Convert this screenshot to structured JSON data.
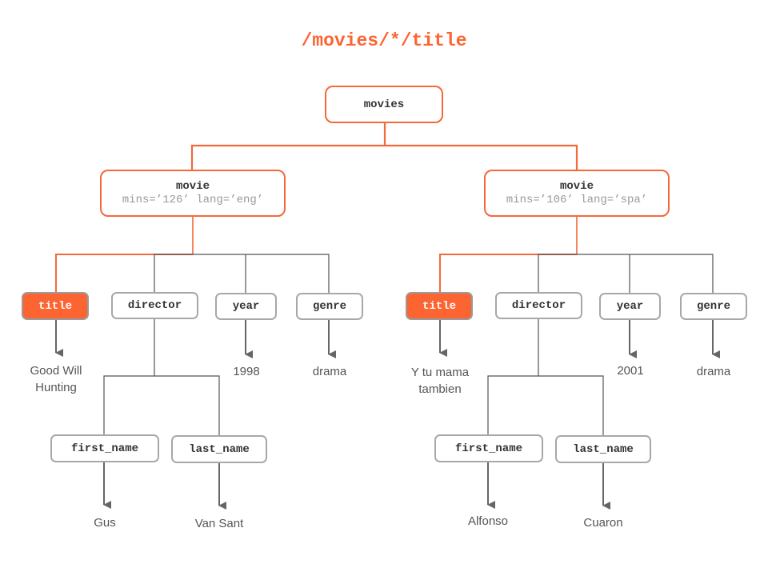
{
  "title": "/movies/*/title",
  "colors": {
    "accent": "#fc6431",
    "edge_highlight": "#f4693a",
    "edge_normal": "#555555",
    "node_border": "#a8a8a8",
    "leaf_text": "#555555"
  },
  "root": {
    "label": "movies"
  },
  "movies": [
    {
      "label": "movie",
      "attributes": "mins=’126’ lang=’eng’",
      "children": {
        "title": {
          "label": "title",
          "value": "Good Will Hunting",
          "value_lines": [
            "Good Will",
            "Hunting"
          ],
          "highlighted": true
        },
        "director": {
          "label": "director",
          "first_name": {
            "label": "first_name",
            "value": "Gus"
          },
          "last_name": {
            "label": "last_name",
            "value": "Van Sant"
          }
        },
        "year": {
          "label": "year",
          "value": "1998"
        },
        "genre": {
          "label": "genre",
          "value": "drama"
        }
      }
    },
    {
      "label": "movie",
      "attributes": "mins=’106’ lang=’spa’",
      "children": {
        "title": {
          "label": "title",
          "value": "Y tu mama tambien",
          "value_lines": [
            "Y tu mama",
            "tambien"
          ],
          "highlighted": true
        },
        "director": {
          "label": "director",
          "first_name": {
            "label": "first_name",
            "value": "Alfonso"
          },
          "last_name": {
            "label": "last_name",
            "value": "Cuaron"
          }
        },
        "year": {
          "label": "year",
          "value": "2001"
        },
        "genre": {
          "label": "genre",
          "value": "drama"
        }
      }
    }
  ]
}
